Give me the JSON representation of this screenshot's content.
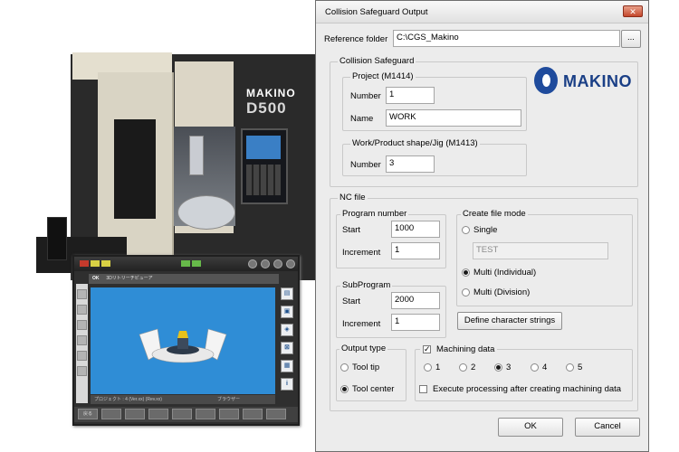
{
  "machine_illustration": {
    "brand": "MAKINO",
    "model": "D500",
    "screen": {
      "tag_left": "OK",
      "title": "3Dリトリーチビューア",
      "status_left": "プロジェクト : 4 (Ver.xx) (Rev.xx)",
      "status_right": "ブラウザー",
      "bottom_label": "戻る"
    }
  },
  "dialog": {
    "title": "Collision Safeguard Output",
    "close_icon": "close-icon",
    "reference_folder": {
      "label": "Reference folder",
      "value": "C:\\CGS_Makino",
      "browse_label": "..."
    },
    "collision_safeguard": {
      "title": "Collision Safeguard",
      "project": {
        "title": "Project (M1414)",
        "number_label": "Number",
        "number_value": "1",
        "name_label": "Name",
        "name_value": "WORK"
      },
      "brand_logo": "MAKINO",
      "work_shape": {
        "title": "Work/Product shape/Jig (M1413)",
        "number_label": "Number",
        "number_value": "3"
      }
    },
    "nc_file": {
      "title": "NC file",
      "program_number": {
        "title": "Program number",
        "start_label": "Start",
        "start_value": "1000",
        "increment_label": "Increment",
        "increment_value": "1"
      },
      "subprogram": {
        "title": "SubProgram",
        "start_label": "Start",
        "start_value": "2000",
        "increment_label": "Increment",
        "increment_value": "1"
      },
      "create_file_mode": {
        "title": "Create file mode",
        "single_label": "Single",
        "single_value": "TEST",
        "multi_individual_label": "Multi (Individual)",
        "multi_division_label": "Multi (Division)",
        "selected": "Multi (Individual)"
      },
      "define_button": "Define character strings",
      "output_type": {
        "title": "Output type",
        "tool_tip_label": "Tool tip",
        "tool_center_label": "Tool center",
        "selected": "Tool center"
      },
      "machining_data": {
        "title": "Machining data",
        "checked": true,
        "options": [
          "1",
          "2",
          "3",
          "4",
          "5"
        ],
        "selected": "3",
        "execute_label": "Execute processing after creating machining data",
        "execute_checked": false
      }
    },
    "ok_label": "OK",
    "cancel_label": "Cancel"
  }
}
